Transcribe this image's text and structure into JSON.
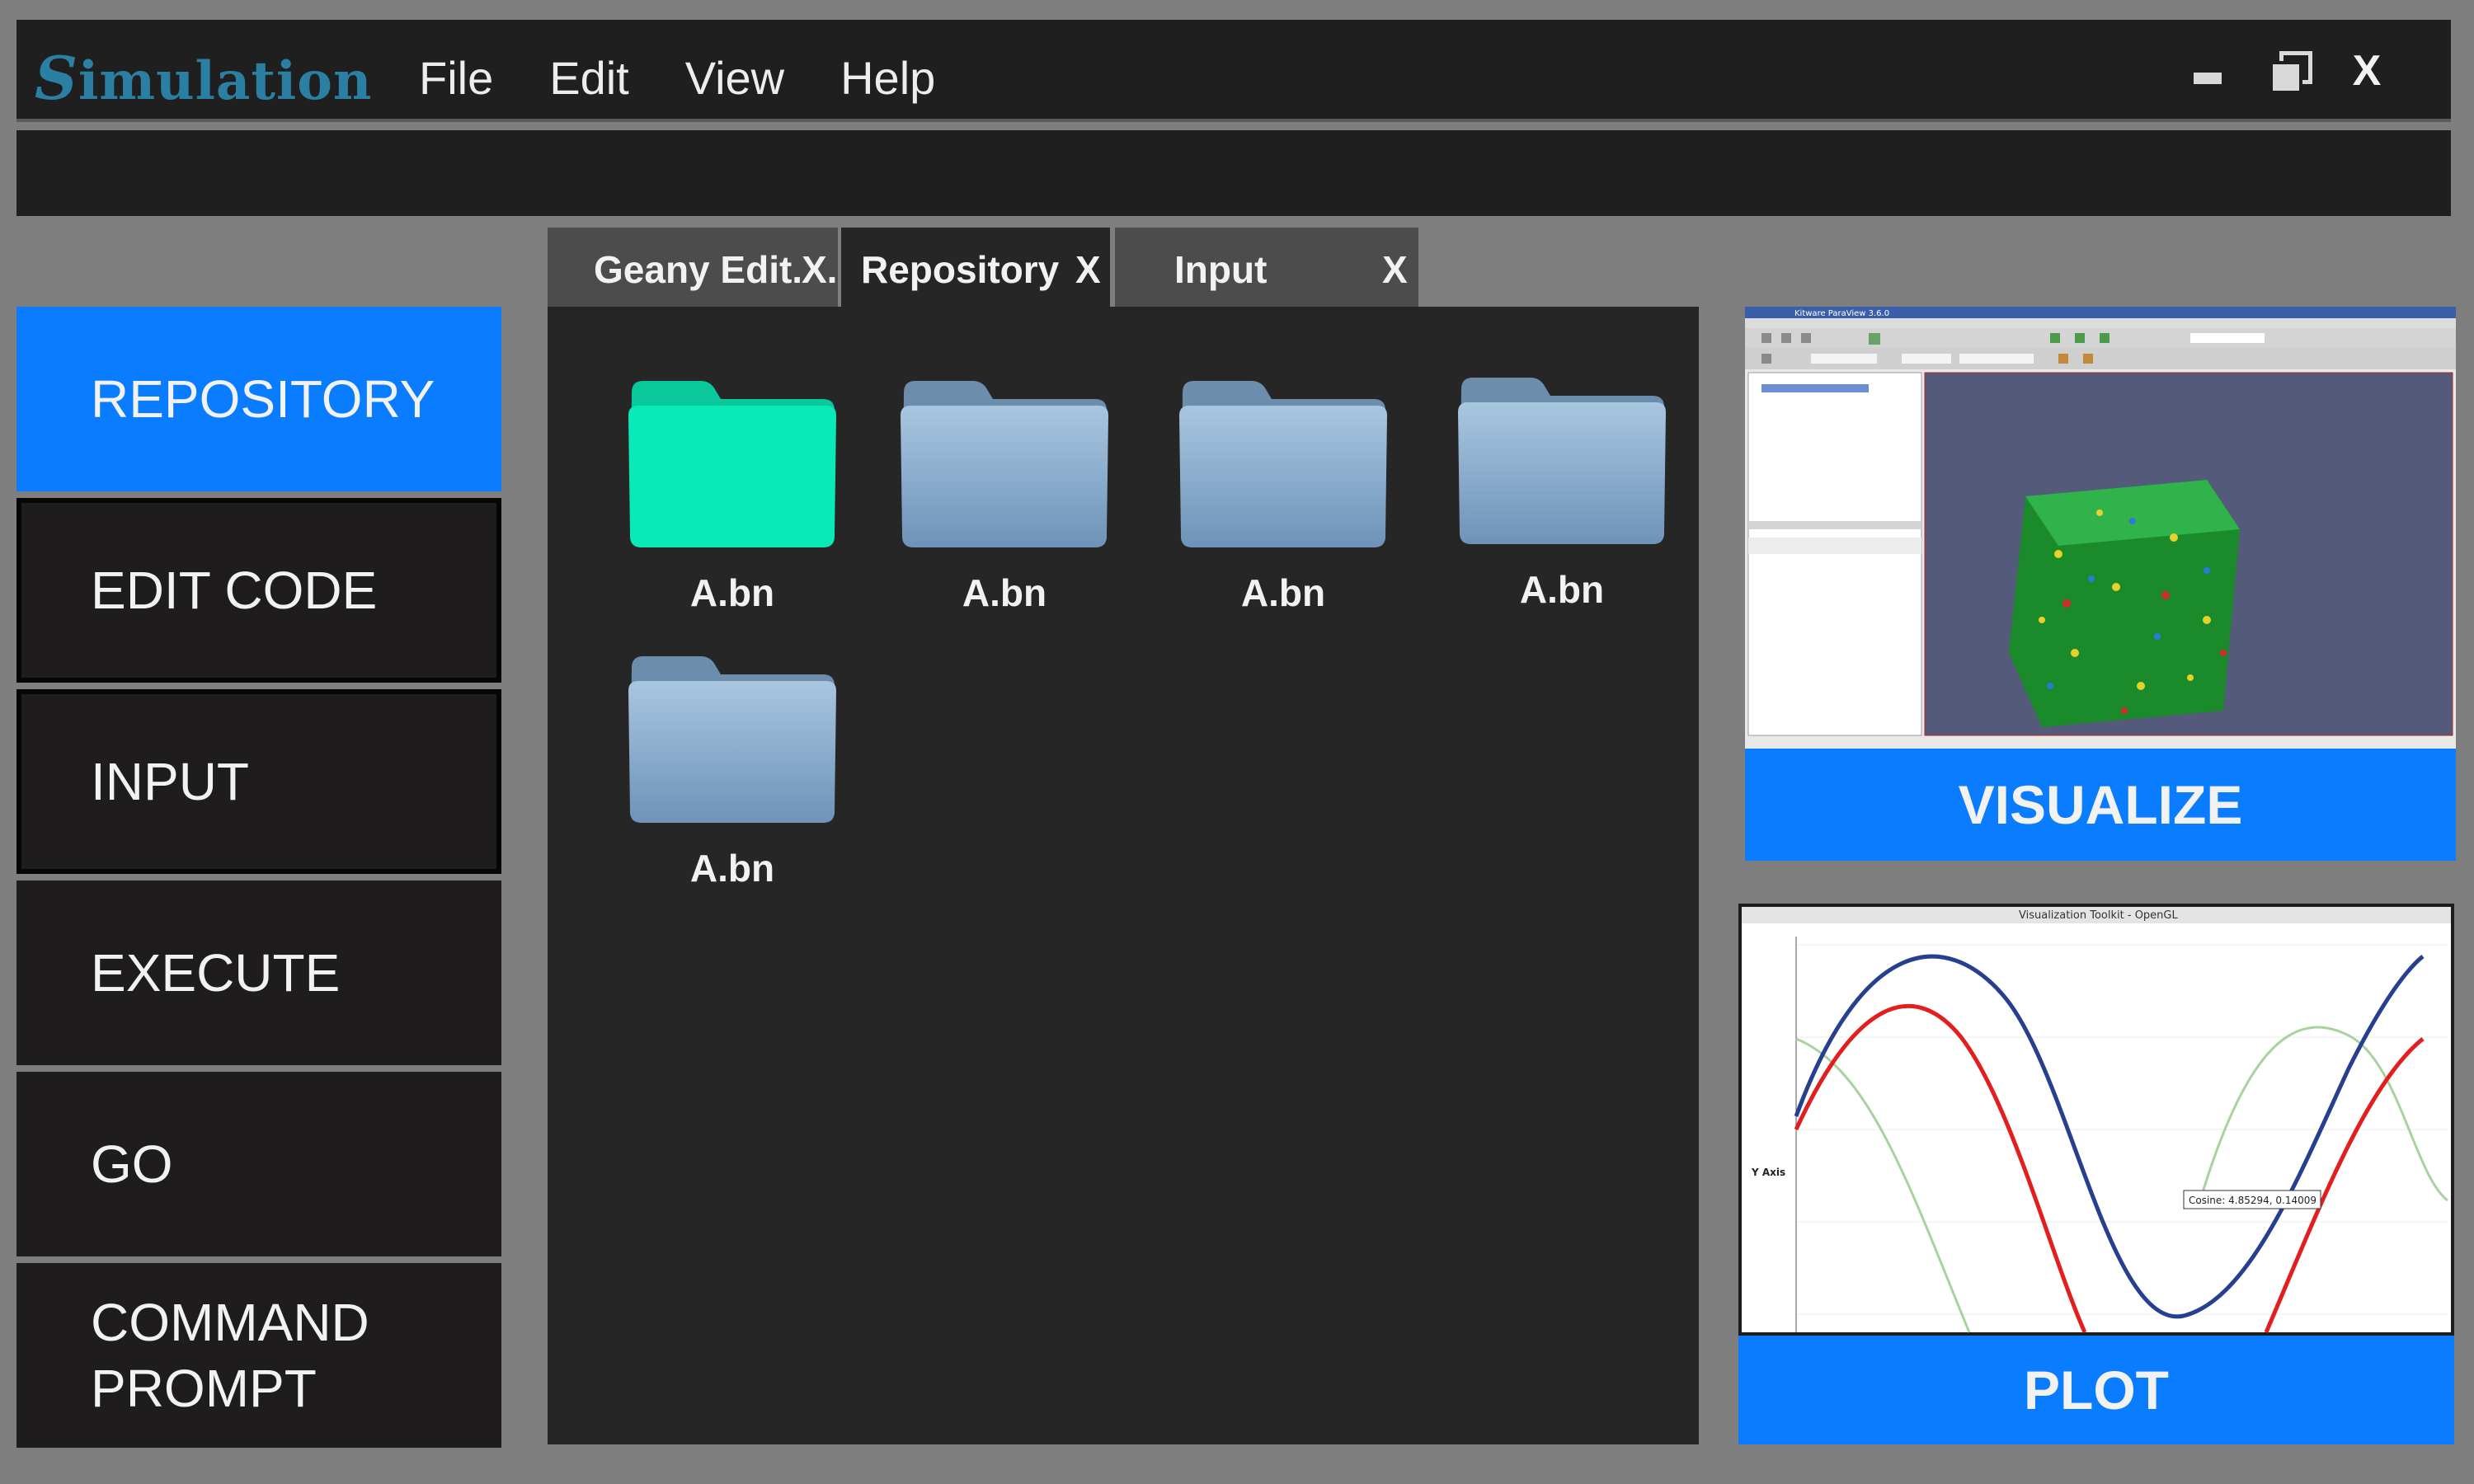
{
  "app": {
    "logo_cap": "S",
    "logo_rest": "imulation",
    "menu": [
      "File",
      "Edit",
      "View",
      "Help"
    ],
    "window_close": "X"
  },
  "nav": [
    {
      "label": "REPOSITORY",
      "active": true
    },
    {
      "label": "EDIT CODE"
    },
    {
      "label": "INPUT"
    },
    {
      "label": "EXECUTE"
    },
    {
      "label": "GO"
    },
    {
      "label": "COMMAND PROMPT"
    }
  ],
  "tabs": [
    {
      "label": "Geany Edit.",
      "close": "X."
    },
    {
      "label": "Repository",
      "close": "X",
      "active": true
    },
    {
      "label": "Input",
      "close": "X"
    }
  ],
  "files": [
    {
      "name": "A.bn",
      "selected": true
    },
    {
      "name": "A.bn"
    },
    {
      "name": "A.bn"
    },
    {
      "name": "A.bn"
    },
    {
      "name": "A.bn"
    }
  ],
  "panels": {
    "visualize": {
      "label": "VISUALIZE",
      "thumb_title": "Kitware ParaView 3.6.0"
    },
    "plot": {
      "label": "PLOT",
      "thumb_title": "Visualization Toolkit - OpenGL",
      "y_axis": "Y Axis",
      "tooltip": "Cosine: 4.85294, 0.14009"
    }
  },
  "colors": {
    "accent": "#0a7cff",
    "selected_folder": "#0aeab8",
    "folder": "#8fb0cf"
  }
}
